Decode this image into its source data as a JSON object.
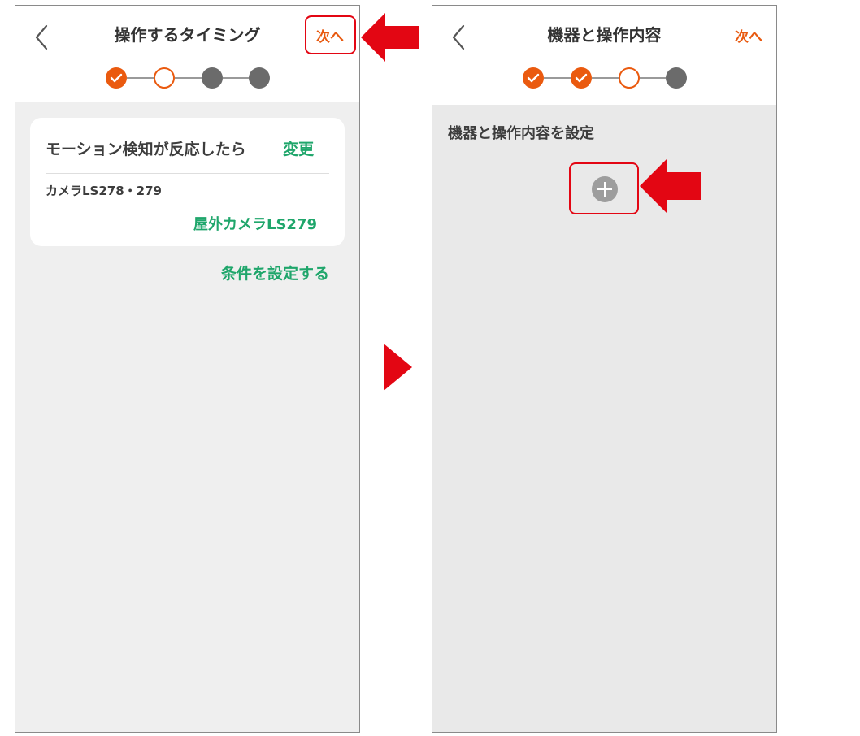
{
  "left_screen": {
    "title": "操作するタイミング",
    "next_label": "次へ",
    "steps": [
      "done",
      "current",
      "todo",
      "todo"
    ],
    "condition_card": {
      "title": "モーション検知が反応したら",
      "change_label": "変更",
      "device_type": "カメラLS278・279",
      "device_name": "屋外カメラLS279"
    },
    "set_condition_label": "条件を設定する"
  },
  "right_screen": {
    "title": "機器と操作内容",
    "next_label": "次へ",
    "steps": [
      "done",
      "done",
      "current",
      "todo"
    ],
    "section_label": "機器と操作内容を設定"
  },
  "colors": {
    "accent_orange": "#ea5a0f",
    "action_green": "#1fa66b",
    "annotation_red": "#e30613"
  },
  "icons": {
    "back": "chevron-left-icon",
    "step_done": "check-icon",
    "add": "plus-circle-icon",
    "annotation": "red-arrow-icon"
  }
}
